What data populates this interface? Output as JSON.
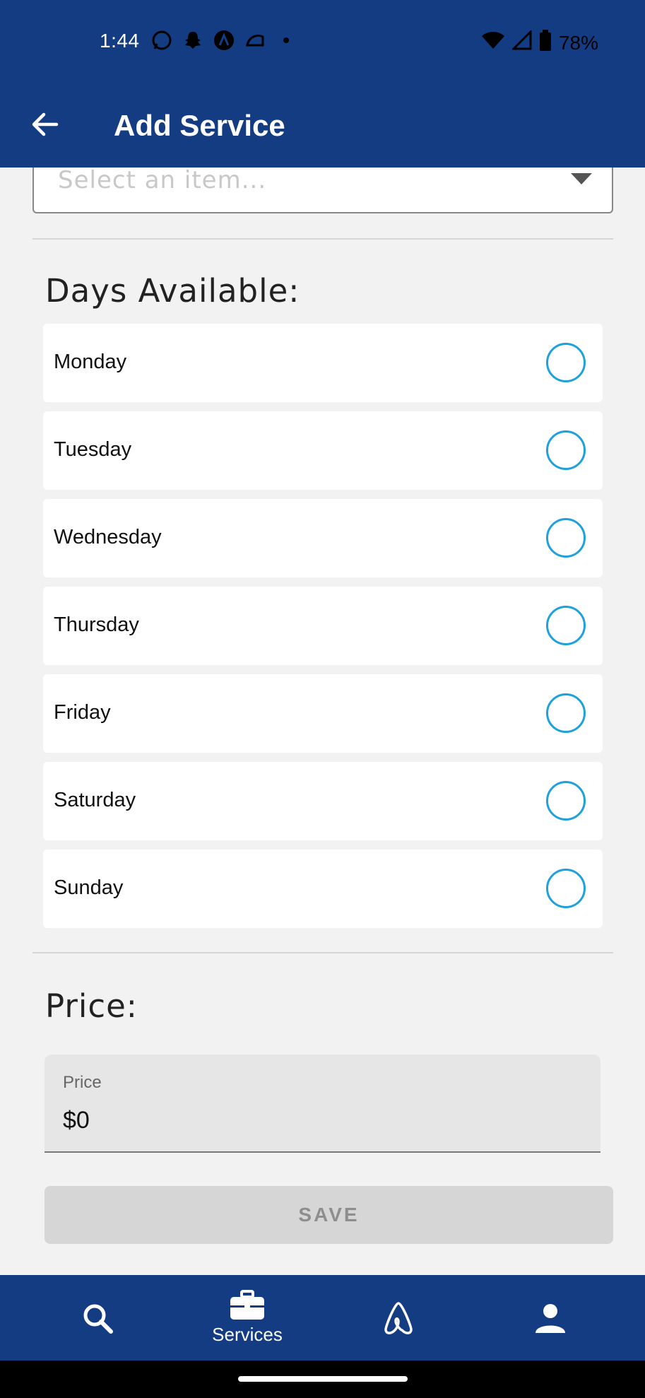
{
  "status_bar": {
    "time": "1:44",
    "battery": "78%",
    "notification_icons": [
      "whatsapp-icon",
      "snapchat-icon",
      "arc-app-icon",
      "taco-bell-icon",
      "dot-icon"
    ]
  },
  "app_bar": {
    "title": "Add Service"
  },
  "item_select": {
    "placeholder": "Select an item..."
  },
  "days_section": {
    "title": "Days Available:",
    "days": [
      {
        "label": "Monday",
        "selected": false
      },
      {
        "label": "Tuesday",
        "selected": false
      },
      {
        "label": "Wednesday",
        "selected": false
      },
      {
        "label": "Thursday",
        "selected": false
      },
      {
        "label": "Friday",
        "selected": false
      },
      {
        "label": "Saturday",
        "selected": false
      },
      {
        "label": "Sunday",
        "selected": false
      }
    ]
  },
  "price_section": {
    "title": "Price:",
    "field_label": "Price",
    "field_value": "$0"
  },
  "save_button": {
    "label": "SAVE"
  },
  "bottom_nav": {
    "items": [
      {
        "icon": "search-icon",
        "label": ""
      },
      {
        "icon": "briefcase-icon",
        "label": "Services"
      },
      {
        "icon": "airbnb-logo-icon",
        "label": ""
      },
      {
        "icon": "person-icon",
        "label": ""
      }
    ]
  },
  "colors": {
    "primary": "#133c83",
    "radio": "#1ea1dc",
    "background": "#f2f2f2"
  }
}
